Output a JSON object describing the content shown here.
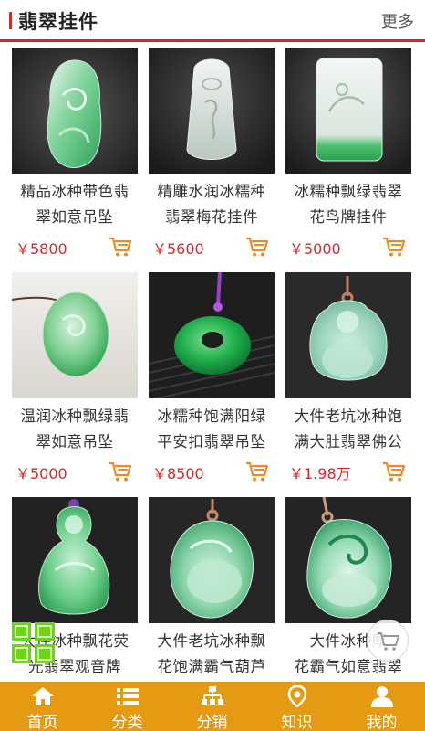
{
  "header": {
    "title": "翡翠挂件",
    "more": "更多"
  },
  "products": [
    {
      "name_line1": "精品冰种带色翡",
      "name_line2": "翠如意吊坠",
      "price": "￥5800",
      "image": "jade-ruyi-pendant"
    },
    {
      "name_line1": "精雕水润冰糯种",
      "name_line2": "翡翠梅花挂件",
      "price": "￥5600",
      "image": "jade-plum-blossom-pendant"
    },
    {
      "name_line1": "冰糯种飘绿翡翠",
      "name_line2": "花鸟牌挂件",
      "price": "￥5000",
      "image": "jade-flower-bird-plaque"
    },
    {
      "name_line1": "温润冰种飘绿翡",
      "name_line2": "翠如意吊坠",
      "price": "￥5000",
      "image": "jade-ruyi-pendant-oval"
    },
    {
      "name_line1": "冰糯种饱满阳绿",
      "name_line2": "平安扣翡翠吊坠",
      "price": "￥8500",
      "image": "jade-safety-buckle"
    },
    {
      "name_line1": "大件老坑冰种饱",
      "name_line2": "满大肚翡翠佛公",
      "price": "￥1.98万",
      "image": "jade-buddha-pendant"
    },
    {
      "name_line1": "大件冰种飘花荧",
      "name_line2": "光翡翠观音牌",
      "price": "",
      "image": "jade-guanyin-pendant"
    },
    {
      "name_line1": "大件老坑冰种飘",
      "name_line2": "花饱满霸气葫芦",
      "price": "",
      "image": "jade-gourd-pendant"
    },
    {
      "name_line1": "大件冰种厚",
      "name_line2": "花霸气如意翡翠",
      "price": "",
      "image": "jade-ruyi-large-pendant"
    }
  ],
  "tabbar": [
    {
      "label": "首页",
      "icon": "home-icon"
    },
    {
      "label": "分类",
      "icon": "list-icon"
    },
    {
      "label": "分销",
      "icon": "distribution-icon"
    },
    {
      "label": "知识",
      "icon": "location-pin-icon"
    },
    {
      "label": "我的",
      "icon": "user-icon"
    }
  ],
  "colors": {
    "accent": "#d9262a",
    "tabbar": "#e49a13",
    "cart": "#f08a24"
  }
}
